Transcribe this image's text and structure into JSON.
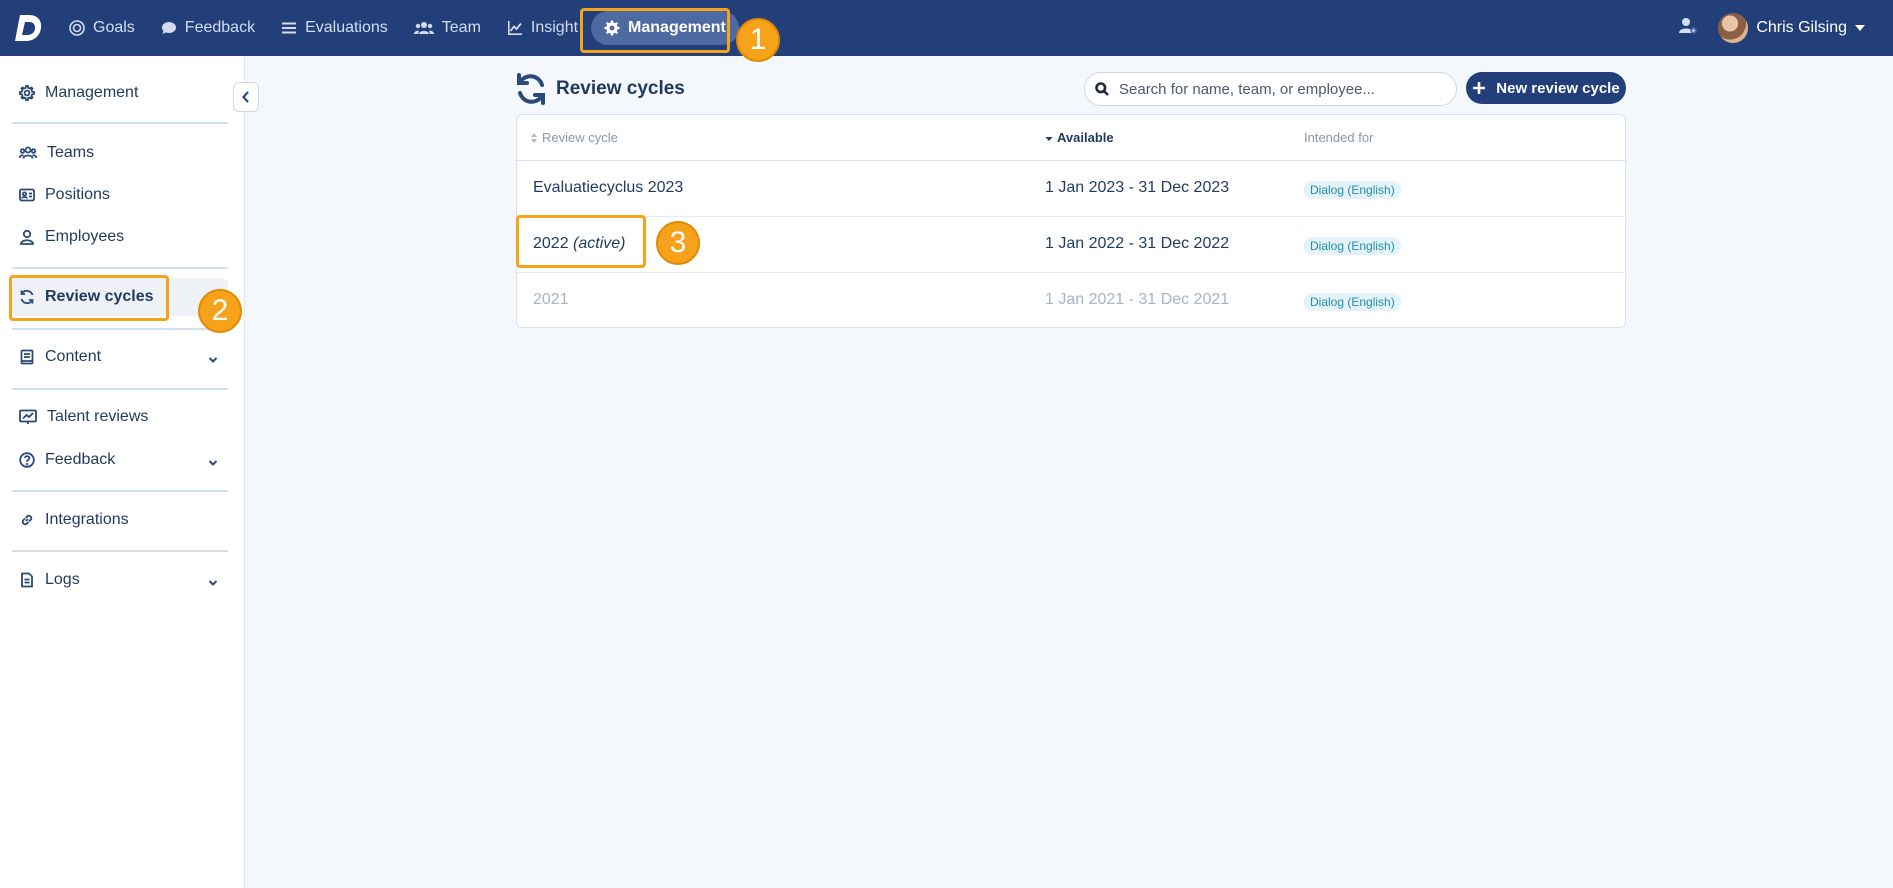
{
  "nav": {
    "items": [
      {
        "label": "Goals",
        "icon": "target-icon"
      },
      {
        "label": "Feedback",
        "icon": "chat-icon"
      },
      {
        "label": "Evaluations",
        "icon": "list-icon"
      },
      {
        "label": "Team",
        "icon": "users-icon"
      },
      {
        "label": "Insight",
        "icon": "chart-icon"
      },
      {
        "label": "Management",
        "icon": "gear-icon",
        "active": true
      }
    ],
    "user_name": "Chris Gilsing"
  },
  "sidebar": {
    "items": [
      {
        "label": "Management"
      },
      {
        "label": "Teams"
      },
      {
        "label": "Positions"
      },
      {
        "label": "Employees"
      },
      {
        "label": "Review cycles",
        "active": true
      },
      {
        "label": "Content",
        "expandable": true
      },
      {
        "label": "Talent reviews"
      },
      {
        "label": "Feedback",
        "expandable": true
      },
      {
        "label": "Integrations"
      },
      {
        "label": "Logs",
        "expandable": true
      }
    ]
  },
  "main": {
    "title": "Review cycles",
    "search_placeholder": "Search for name, team, or employee...",
    "new_button": "New review cycle",
    "columns": [
      "Review cycle",
      "Available",
      "Intended for"
    ],
    "rows": [
      {
        "name": "Evaluatiecyclus 2023",
        "suffix": "",
        "available": "1 Jan 2023 - 31 Dec 2023",
        "intended_for": "Dialog (English)"
      },
      {
        "name": "2022",
        "suffix": "(active)",
        "available": "1 Jan 2022 - 31 Dec 2022",
        "intended_for": "Dialog (English)"
      },
      {
        "name": "2021",
        "suffix": "",
        "available": "1 Jan 2021 - 31 Dec 2021",
        "intended_for": "Dialog (English)"
      }
    ]
  },
  "annotations": {
    "step1": "1",
    "step2": "2",
    "step3": "3"
  },
  "colors": {
    "primary": "#223f7a",
    "highlight": "#f7a21b",
    "tag": "#1f8fa8"
  }
}
